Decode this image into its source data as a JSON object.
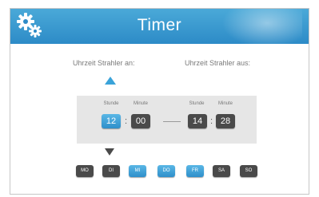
{
  "header": {
    "title": "Timer",
    "icon": "gear-icon"
  },
  "labels": {
    "on": "Uhrzeit Strahler an:",
    "off": "Uhrzeit Strahler aus:"
  },
  "on_time": {
    "hour_label": "Stunde",
    "minute_label": "Minute",
    "hour": "12",
    "minute": "00",
    "hour_selected": true
  },
  "off_time": {
    "hour_label": "Stunde",
    "minute_label": "Minute",
    "hour": "14",
    "minute": "28"
  },
  "separator": ":",
  "days": [
    {
      "label": "MO",
      "active": false
    },
    {
      "label": "DI",
      "active": false
    },
    {
      "label": "MI",
      "active": true
    },
    {
      "label": "DO",
      "active": true
    },
    {
      "label": "FR",
      "active": true
    },
    {
      "label": "SA",
      "active": false
    },
    {
      "label": "SO",
      "active": false
    }
  ],
  "colors": {
    "accent": "#2e8fca",
    "inactive": "#4a4a4a",
    "panel": "#e6e6e6"
  }
}
